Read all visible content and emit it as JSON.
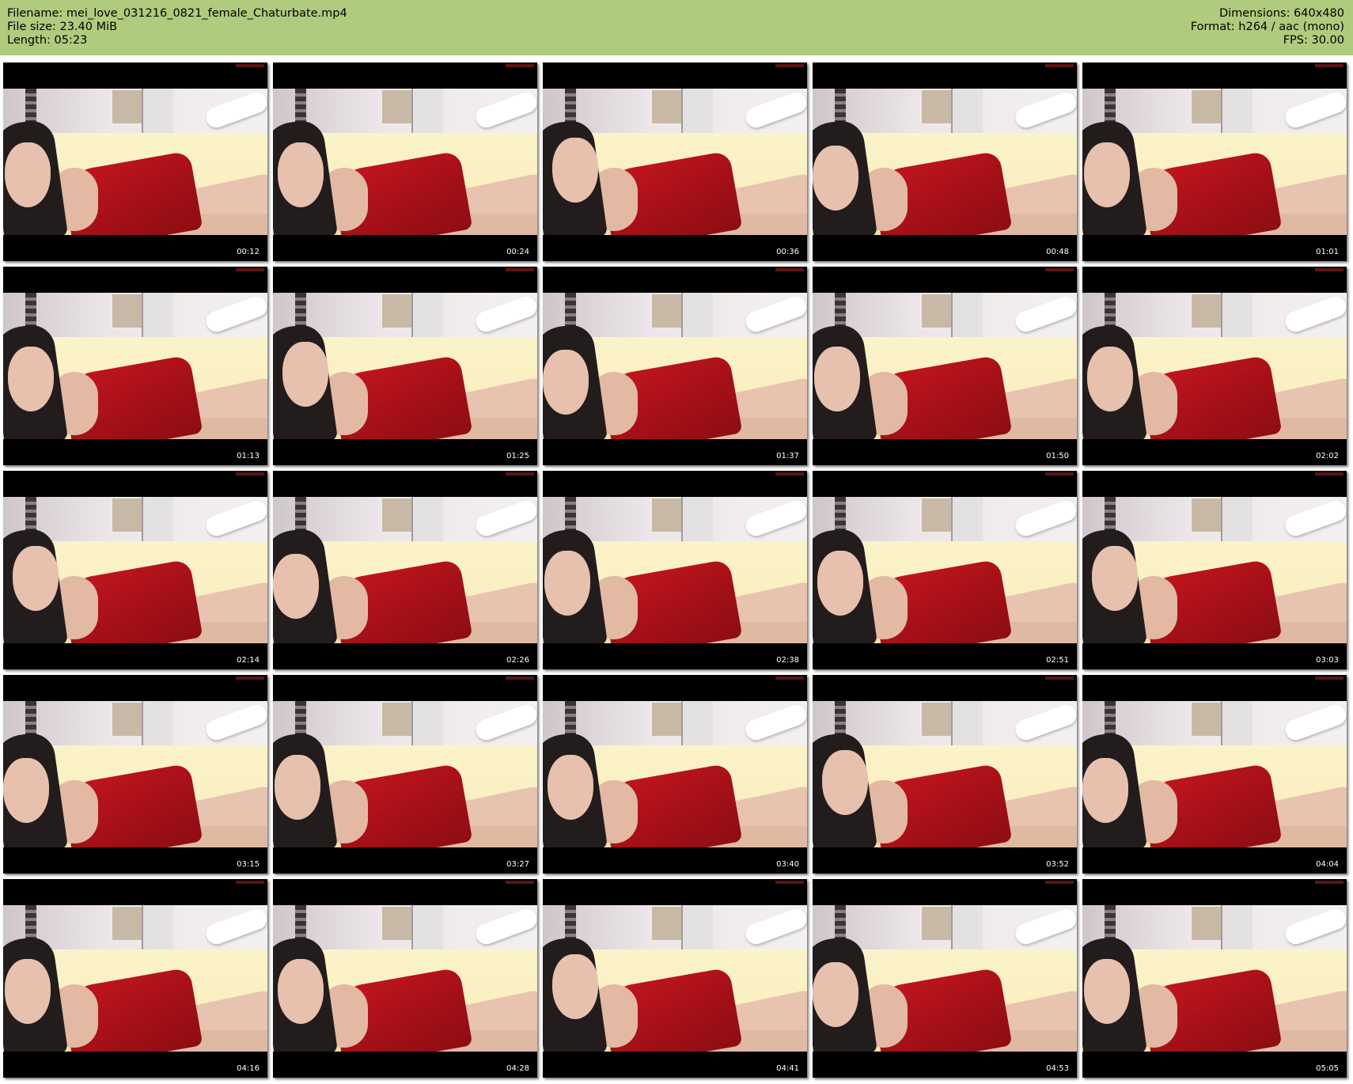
{
  "header": {
    "filename": "Filename: mei_love_031216_0821_female_Chaturbate.mp4",
    "filesize": "File size: 23.40 MiB",
    "length": "Length: 05:23",
    "dimensions": "Dimensions: 640x480",
    "format": "Format: h264 / aac (mono)",
    "fps": "FPS: 30.00"
  },
  "thumbnails": [
    {
      "timestamp": "00:12"
    },
    {
      "timestamp": "00:24"
    },
    {
      "timestamp": "00:36"
    },
    {
      "timestamp": "00:48"
    },
    {
      "timestamp": "01:01"
    },
    {
      "timestamp": "01:13"
    },
    {
      "timestamp": "01:25"
    },
    {
      "timestamp": "01:37"
    },
    {
      "timestamp": "01:50"
    },
    {
      "timestamp": "02:02"
    },
    {
      "timestamp": "02:14"
    },
    {
      "timestamp": "02:26"
    },
    {
      "timestamp": "02:38"
    },
    {
      "timestamp": "02:51"
    },
    {
      "timestamp": "03:03"
    },
    {
      "timestamp": "03:15"
    },
    {
      "timestamp": "03:27"
    },
    {
      "timestamp": "03:40"
    },
    {
      "timestamp": "03:52"
    },
    {
      "timestamp": "04:04"
    },
    {
      "timestamp": "04:16"
    },
    {
      "timestamp": "04:28"
    },
    {
      "timestamp": "04:41"
    },
    {
      "timestamp": "04:53"
    },
    {
      "timestamp": "05:05"
    }
  ],
  "colors": {
    "header_bg": "#afcb7d",
    "letterbox": "#000000",
    "dress": "#c3161f"
  }
}
